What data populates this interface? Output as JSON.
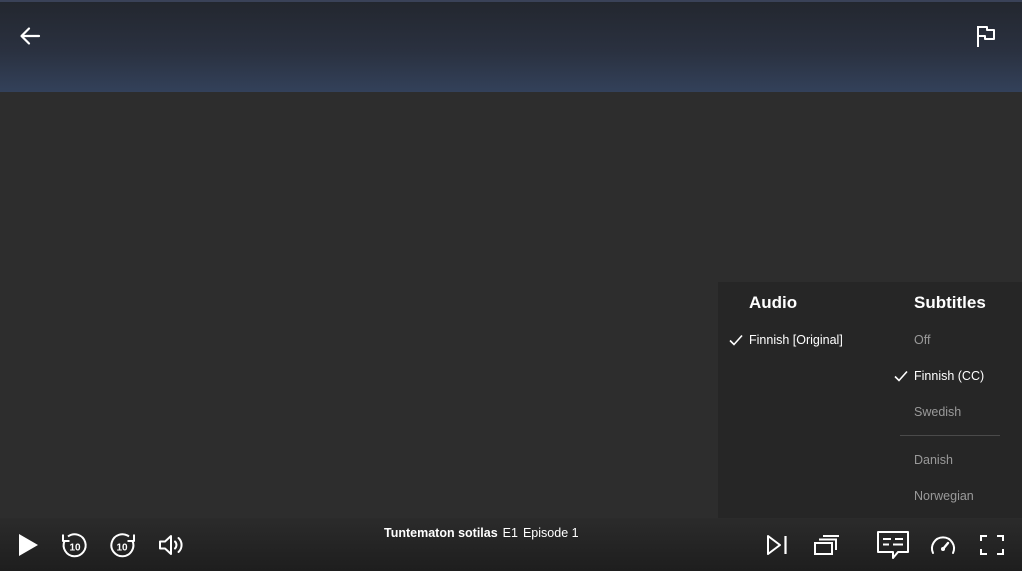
{
  "player": {
    "show_title": "Tuntematon sotilas",
    "episode_code": "E1",
    "episode_name": "Episode 1"
  },
  "menu": {
    "audio": {
      "heading": "Audio",
      "options": [
        {
          "label": "Finnish [Original]",
          "selected": true
        }
      ]
    },
    "subtitles": {
      "heading": "Subtitles",
      "options": [
        {
          "label": "Off",
          "selected": false
        },
        {
          "label": "Finnish (CC)",
          "selected": true
        },
        {
          "label": "Swedish",
          "selected": false
        },
        {
          "label": "Danish",
          "selected": false
        },
        {
          "label": "Norwegian",
          "selected": false
        }
      ]
    }
  },
  "skip": {
    "back_seconds": "10",
    "forward_seconds": "10"
  },
  "icons": {
    "back": "arrow-left-icon",
    "report": "flag-icon",
    "play": "play-icon",
    "rewind": "rewind-10-icon",
    "forward": "forward-10-icon",
    "volume": "volume-icon",
    "next_episode": "next-episode-icon",
    "episodes": "episodes-icon",
    "subtitles": "subtitles-icon",
    "speed": "playback-speed-icon",
    "fullscreen": "fullscreen-icon",
    "check": "check-icon"
  },
  "colors": {
    "background": "#2d2d2d",
    "menu_background": "#262626",
    "text_primary": "#ffffff",
    "text_muted": "#9a9a9a"
  }
}
